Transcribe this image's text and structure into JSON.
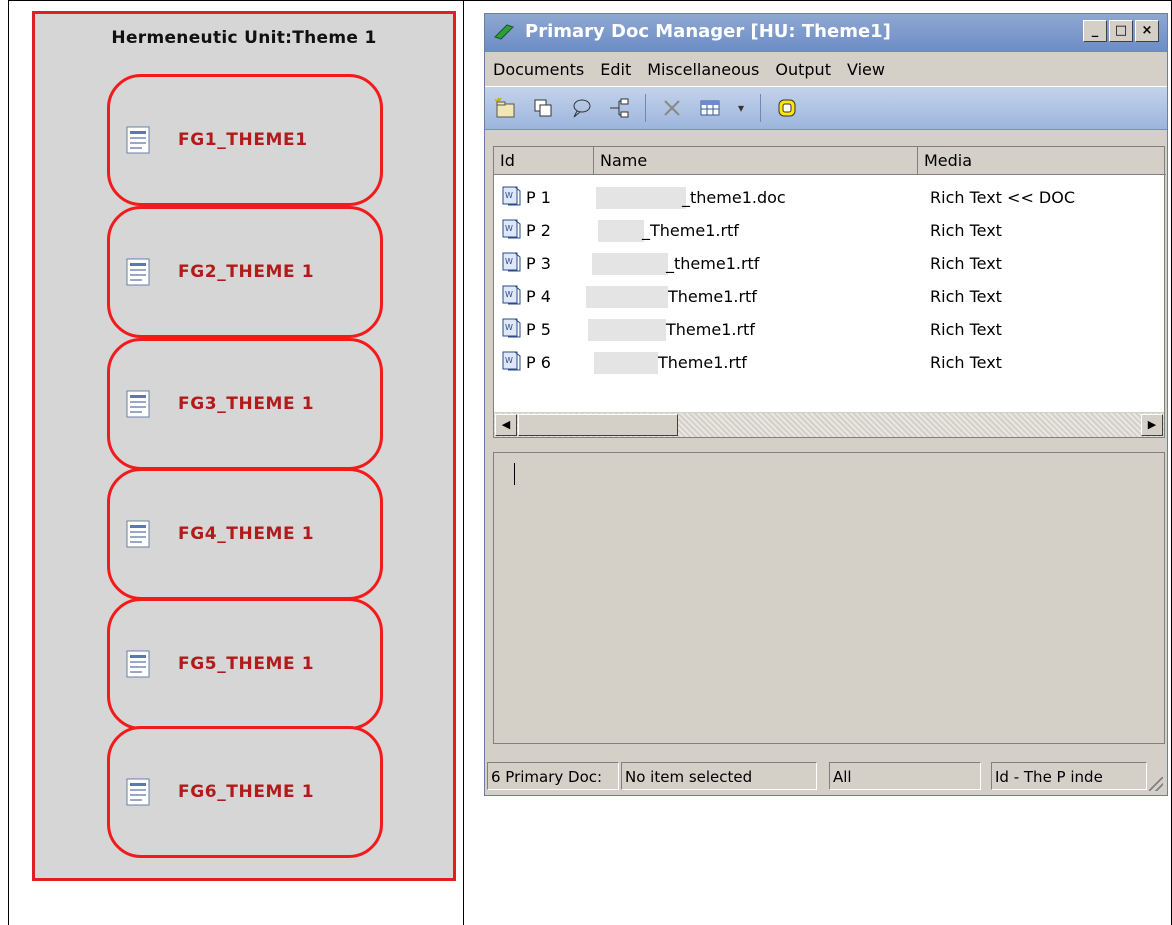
{
  "hu_panel": {
    "title": "Hermeneutic Unit:Theme 1",
    "docs": [
      "FG1_THEME1",
      "FG2_THEME 1",
      "FG3_THEME 1",
      "FG4_THEME 1",
      "FG5_THEME 1",
      "FG6_THEME 1"
    ]
  },
  "window": {
    "title": "Primary Doc Manager [HU: Theme1]",
    "controls": {
      "minimize": "_",
      "maximize": "□",
      "close": "×"
    },
    "menu": [
      "Documents",
      "Edit",
      "Miscellaneous",
      "Output",
      "View"
    ],
    "toolbar_icons": [
      "new-document-icon",
      "copy-icon",
      "comment-icon",
      "tree-icon",
      "delete-icon",
      "table-icon",
      "dropdown-arrow-icon",
      "highlight-icon"
    ],
    "columns": {
      "id": "Id",
      "name": "Name",
      "media": "Media"
    },
    "rows": [
      {
        "id": "P 1",
        "name": "_theme1.doc",
        "media": "Rich Text << DOC"
      },
      {
        "id": "P 2",
        "name": "_Theme1.rtf",
        "media": "Rich Text"
      },
      {
        "id": "P 3",
        "name": "_theme1.rtf",
        "media": "Rich Text"
      },
      {
        "id": "P 4",
        "name": "Theme1.rtf",
        "media": "Rich Text"
      },
      {
        "id": "P 5",
        "name": "Theme1.rtf",
        "media": "Rich Text"
      },
      {
        "id": "P 6",
        "name": "Theme1.rtf",
        "media": "Rich Text"
      }
    ],
    "status": {
      "count": "6 Primary Doc:",
      "selection": "No item selected",
      "filter": "All",
      "sort": "Id - The P inde"
    }
  }
}
